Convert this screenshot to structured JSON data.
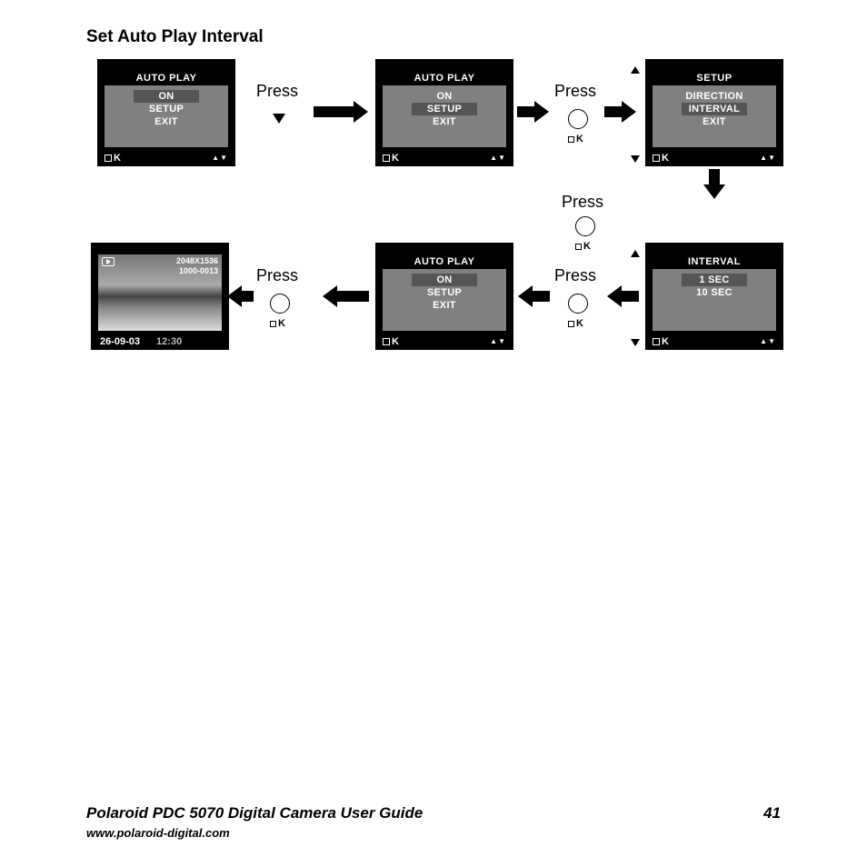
{
  "title": "Set Auto Play Interval",
  "press": "Press",
  "ok": "K",
  "screens": {
    "s1": {
      "title": "AUTO PLAY",
      "items": [
        "ON",
        "SETUP",
        "EXIT"
      ],
      "selected": 0
    },
    "s2": {
      "title": "AUTO PLAY",
      "items": [
        "ON",
        "SETUP",
        "EXIT"
      ],
      "selected": 1
    },
    "s3": {
      "title": "SETUP",
      "items": [
        "DIRECTION",
        "INTERVAL",
        "EXIT"
      ],
      "selected": 1
    },
    "s4": {
      "title": "INTERVAL",
      "items": [
        "1 SEC",
        "10 SEC"
      ],
      "selected": 0
    },
    "s5": {
      "title": "AUTO PLAY",
      "items": [
        "ON",
        "SETUP",
        "EXIT"
      ],
      "selected": 0
    }
  },
  "photo": {
    "resolution": "2048X1536",
    "counter": "1000-0013",
    "date": "26-09-03",
    "time": "12:30"
  },
  "footer": {
    "guide": "Polaroid PDC 5070 Digital Camera User Guide",
    "page": "41",
    "url": "www.polaroid-digital.com"
  }
}
